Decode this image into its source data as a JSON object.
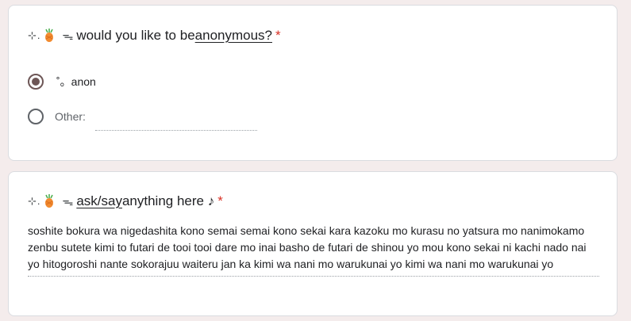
{
  "questions": [
    {
      "prefix": "⊹.",
      "title_before": "would you like to be ",
      "title_link": "anonymous?",
      "title_after": "",
      "required_mark": "*",
      "options": [
        {
          "label": "˚。anon",
          "selected": true
        },
        {
          "label": "Other:",
          "selected": false,
          "value": ""
        }
      ]
    },
    {
      "prefix": "⊹.",
      "title_before": "",
      "title_link": "ask/say",
      "title_after": " anything here ♪",
      "required_mark": "*",
      "answer": "soshite bokura wa nigedashita kono semai semai kono sekai kara kazoku mo kurasu no yatsura mo nanimokamo zenbu sutete kimi to futari de tooi tooi dare mo inai basho de futari de shinou yo mou kono sekai ni kachi nado nai yo hitogoroshi nante sokorajuu waiteru jan ka kimi wa nani mo warukunai yo kimi wa nani mo warukunai yo"
    }
  ],
  "icons": {
    "fruit": "pineapple-icon",
    "ribbon": "ribbon-icon"
  },
  "colors": {
    "background": "#f4ecec",
    "radio_selected": "#6d5656",
    "required": "#d93025"
  }
}
